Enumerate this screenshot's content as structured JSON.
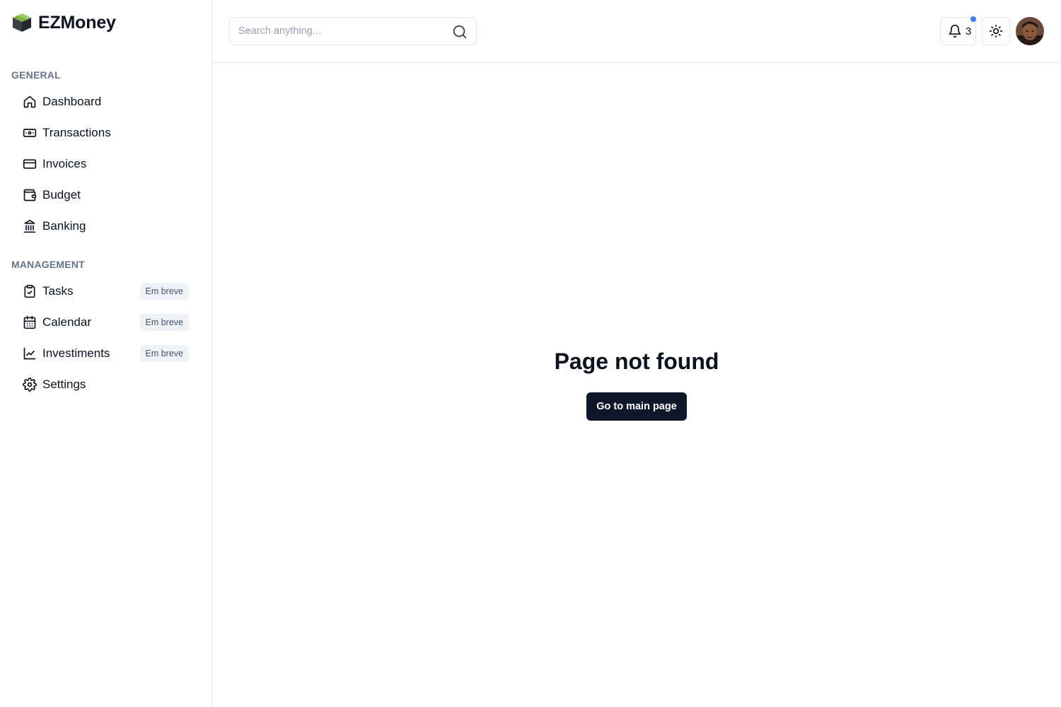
{
  "brand": {
    "name": "EZMoney",
    "logo_icon": "cube-logo-icon"
  },
  "sidebar": {
    "general_title": "GENERAL",
    "general_items": [
      {
        "label": "Dashboard",
        "icon": "home-icon"
      },
      {
        "label": "Transactions",
        "icon": "banknote-icon"
      },
      {
        "label": "Invoices",
        "icon": "credit-card-icon"
      },
      {
        "label": "Budget",
        "icon": "wallet-icon"
      },
      {
        "label": "Banking",
        "icon": "landmark-icon"
      }
    ],
    "management_title": "MANAGEMENT",
    "management_items": [
      {
        "label": "Tasks",
        "icon": "clipboard-check-icon",
        "badge": "Em breve"
      },
      {
        "label": "Calendar",
        "icon": "calendar-icon",
        "badge": "Em breve"
      },
      {
        "label": "Investiments",
        "icon": "line-chart-icon",
        "badge": "Em breve"
      },
      {
        "label": "Settings",
        "icon": "gear-icon"
      }
    ]
  },
  "header": {
    "search": {
      "placeholder": "Search anything...",
      "value": ""
    },
    "notifications": {
      "count": "3",
      "icon": "bell-icon",
      "dot_color": "#3b82f6"
    },
    "theme_icon": "sun-icon"
  },
  "main": {
    "title": "Page not found",
    "button_label": "Go to main page"
  },
  "colors": {
    "accent": "#0f172a",
    "muted": "#64748b",
    "badge_bg": "#eef1f5"
  }
}
